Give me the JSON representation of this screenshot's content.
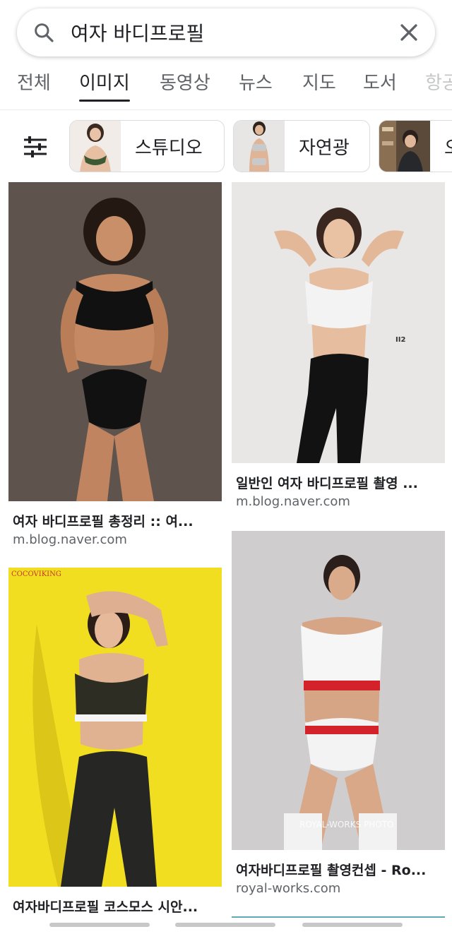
{
  "search": {
    "query": "여자 바디프로필",
    "search_icon": "search-icon",
    "clear_icon": "close-icon"
  },
  "tabs": [
    {
      "label": "전체",
      "active": false
    },
    {
      "label": "이미지",
      "active": true
    },
    {
      "label": "동영상",
      "active": false
    },
    {
      "label": "뉴스",
      "active": false
    },
    {
      "label": "지도",
      "active": false
    },
    {
      "label": "도서",
      "active": false
    },
    {
      "label": "항공",
      "active": false
    }
  ],
  "chips": {
    "tune_icon": "tune-icon",
    "items": [
      {
        "label": "스튜디오"
      },
      {
        "label": "자연광"
      },
      {
        "label": "오"
      }
    ]
  },
  "results": [
    {
      "title": "여자 바디프로필 총정리 :: 여...",
      "source": "m.blog.naver.com"
    },
    {
      "title": "일반인 여자 바디프로필 촬영 ...",
      "source": "m.blog.naver.com"
    },
    {
      "title": "",
      "source": "",
      "watermark": "COCOVIKING"
    },
    {
      "title": "여자바디프로필 촬영컨셉 - Ro...",
      "source": "royal-works.com",
      "watermark": "ROYAL-WORKS PHOTO"
    },
    {
      "title": "여자바디프로필 코스모스 시안...",
      "source": ""
    }
  ],
  "colors": {
    "text": "#202124",
    "muted": "#5f6368",
    "divider": "#ebebeb"
  }
}
